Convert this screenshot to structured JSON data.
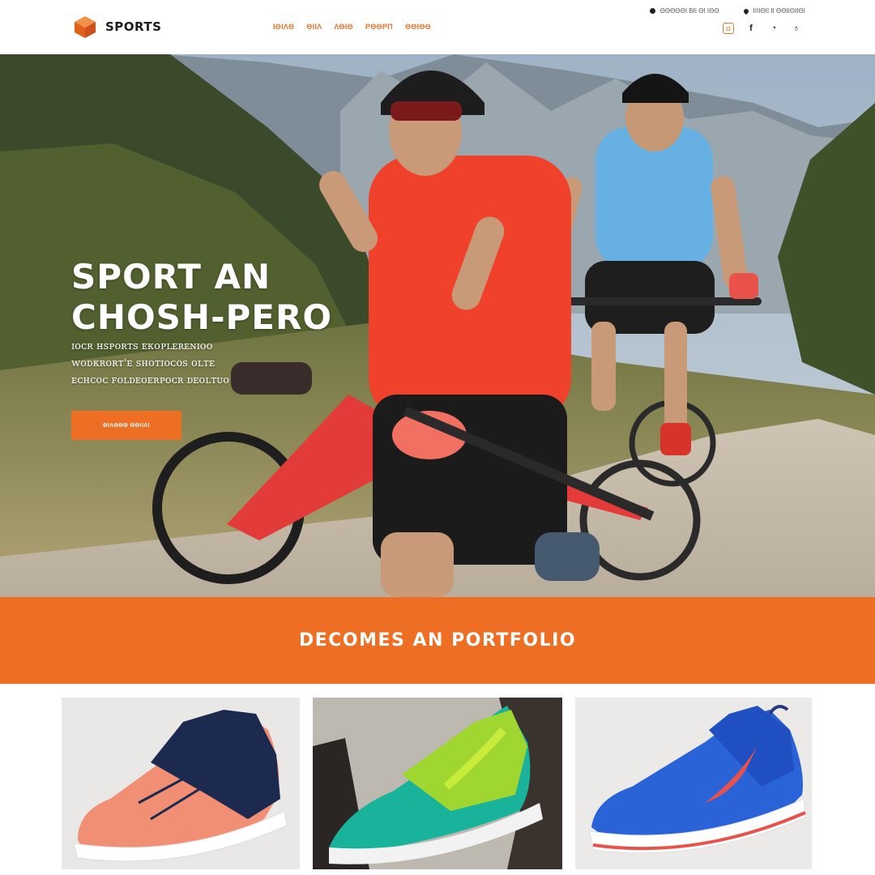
{
  "brand": {
    "name": "SPORTS",
    "logo_icon": "cube-logo-icon",
    "accent": "#ee6f24"
  },
  "nav": {
    "items": [
      "ΙΘΙΛΘ",
      "ΘΙΙΛ",
      "ΛΘΙΘ",
      "ΡΘΘΡΠ",
      "ΘΘΙΘΘ"
    ]
  },
  "utility": {
    "search_text": "ΘΘΘΘΘΙ ΒΙΙ ΘΙ ΙΘΘ",
    "location_text": "ΙΙΙΙΘΙΙ ΙΙ ΘΘΙΙΘΙΙΘΙ"
  },
  "social_icons": [
    "instagram-icon",
    "facebook-icon",
    "circle-icon",
    "user-icon"
  ],
  "hero": {
    "title_line1": "SPORT AN",
    "title_line2": "CHOSH-PERO",
    "subtitle_line1": "ɪᴏᴄʀ ʜꜱᴘᴏʀᴛꜱ ᴇᴋᴏᴘʟᴇʀᴇɴɪᴏᴏ",
    "subtitle_line2": "ᴡᴏᴅᴋʀᴏʀᴛ'ᴇ ꜱʜᴏᴛɪᴏᴄᴏꜱ ᴏʟᴛᴇ",
    "subtitle_line3": "ᴇᴄʜᴄᴏᴄ ꜰᴏʟᴅᴇᴏᴇʀᴘᴏᴄʀ ᴅᴇᴏʟᴛᴜᴏ",
    "cta_label": "ΘΙΛΘΘΘ ΘΘΙΙΛΙ"
  },
  "banner": {
    "title": "DECOMES AN PORTFOLIO"
  },
  "products": [
    {
      "name": "navy-coral-sneaker",
      "colors": [
        "#1c2a4f",
        "#f08f73"
      ]
    },
    {
      "name": "green-mesh-sneaker",
      "colors": [
        "#9bd12f",
        "#1ab49a"
      ]
    },
    {
      "name": "blue-red-sneaker",
      "colors": [
        "#2a63d8",
        "#e8524a"
      ]
    }
  ]
}
